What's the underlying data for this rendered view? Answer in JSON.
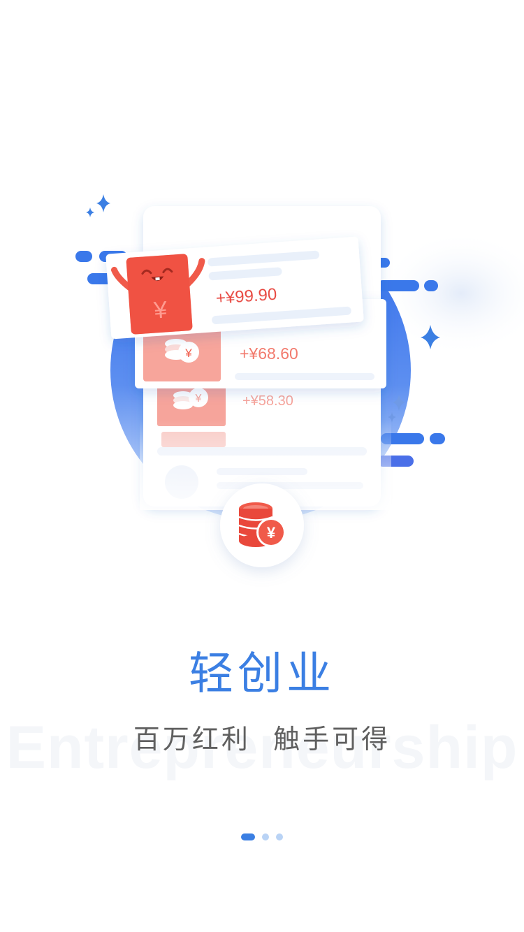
{
  "cards": {
    "amount_top": "+¥99.90",
    "amount_middle": "+¥68.60",
    "amount_bottom": "+¥58.30"
  },
  "envelope": {
    "symbol": "¥"
  },
  "coin": {
    "symbol": "¥"
  },
  "headline": "轻创业",
  "subheadline": "百万红利  触手可得",
  "watermark": "Entrepreneurship",
  "pager": {
    "count": 3,
    "active_index": 0
  },
  "colors": {
    "brand_blue": "#3b7fe3",
    "money_red": "#f05a4a",
    "subtitle_gray": "#5f5f5f"
  }
}
